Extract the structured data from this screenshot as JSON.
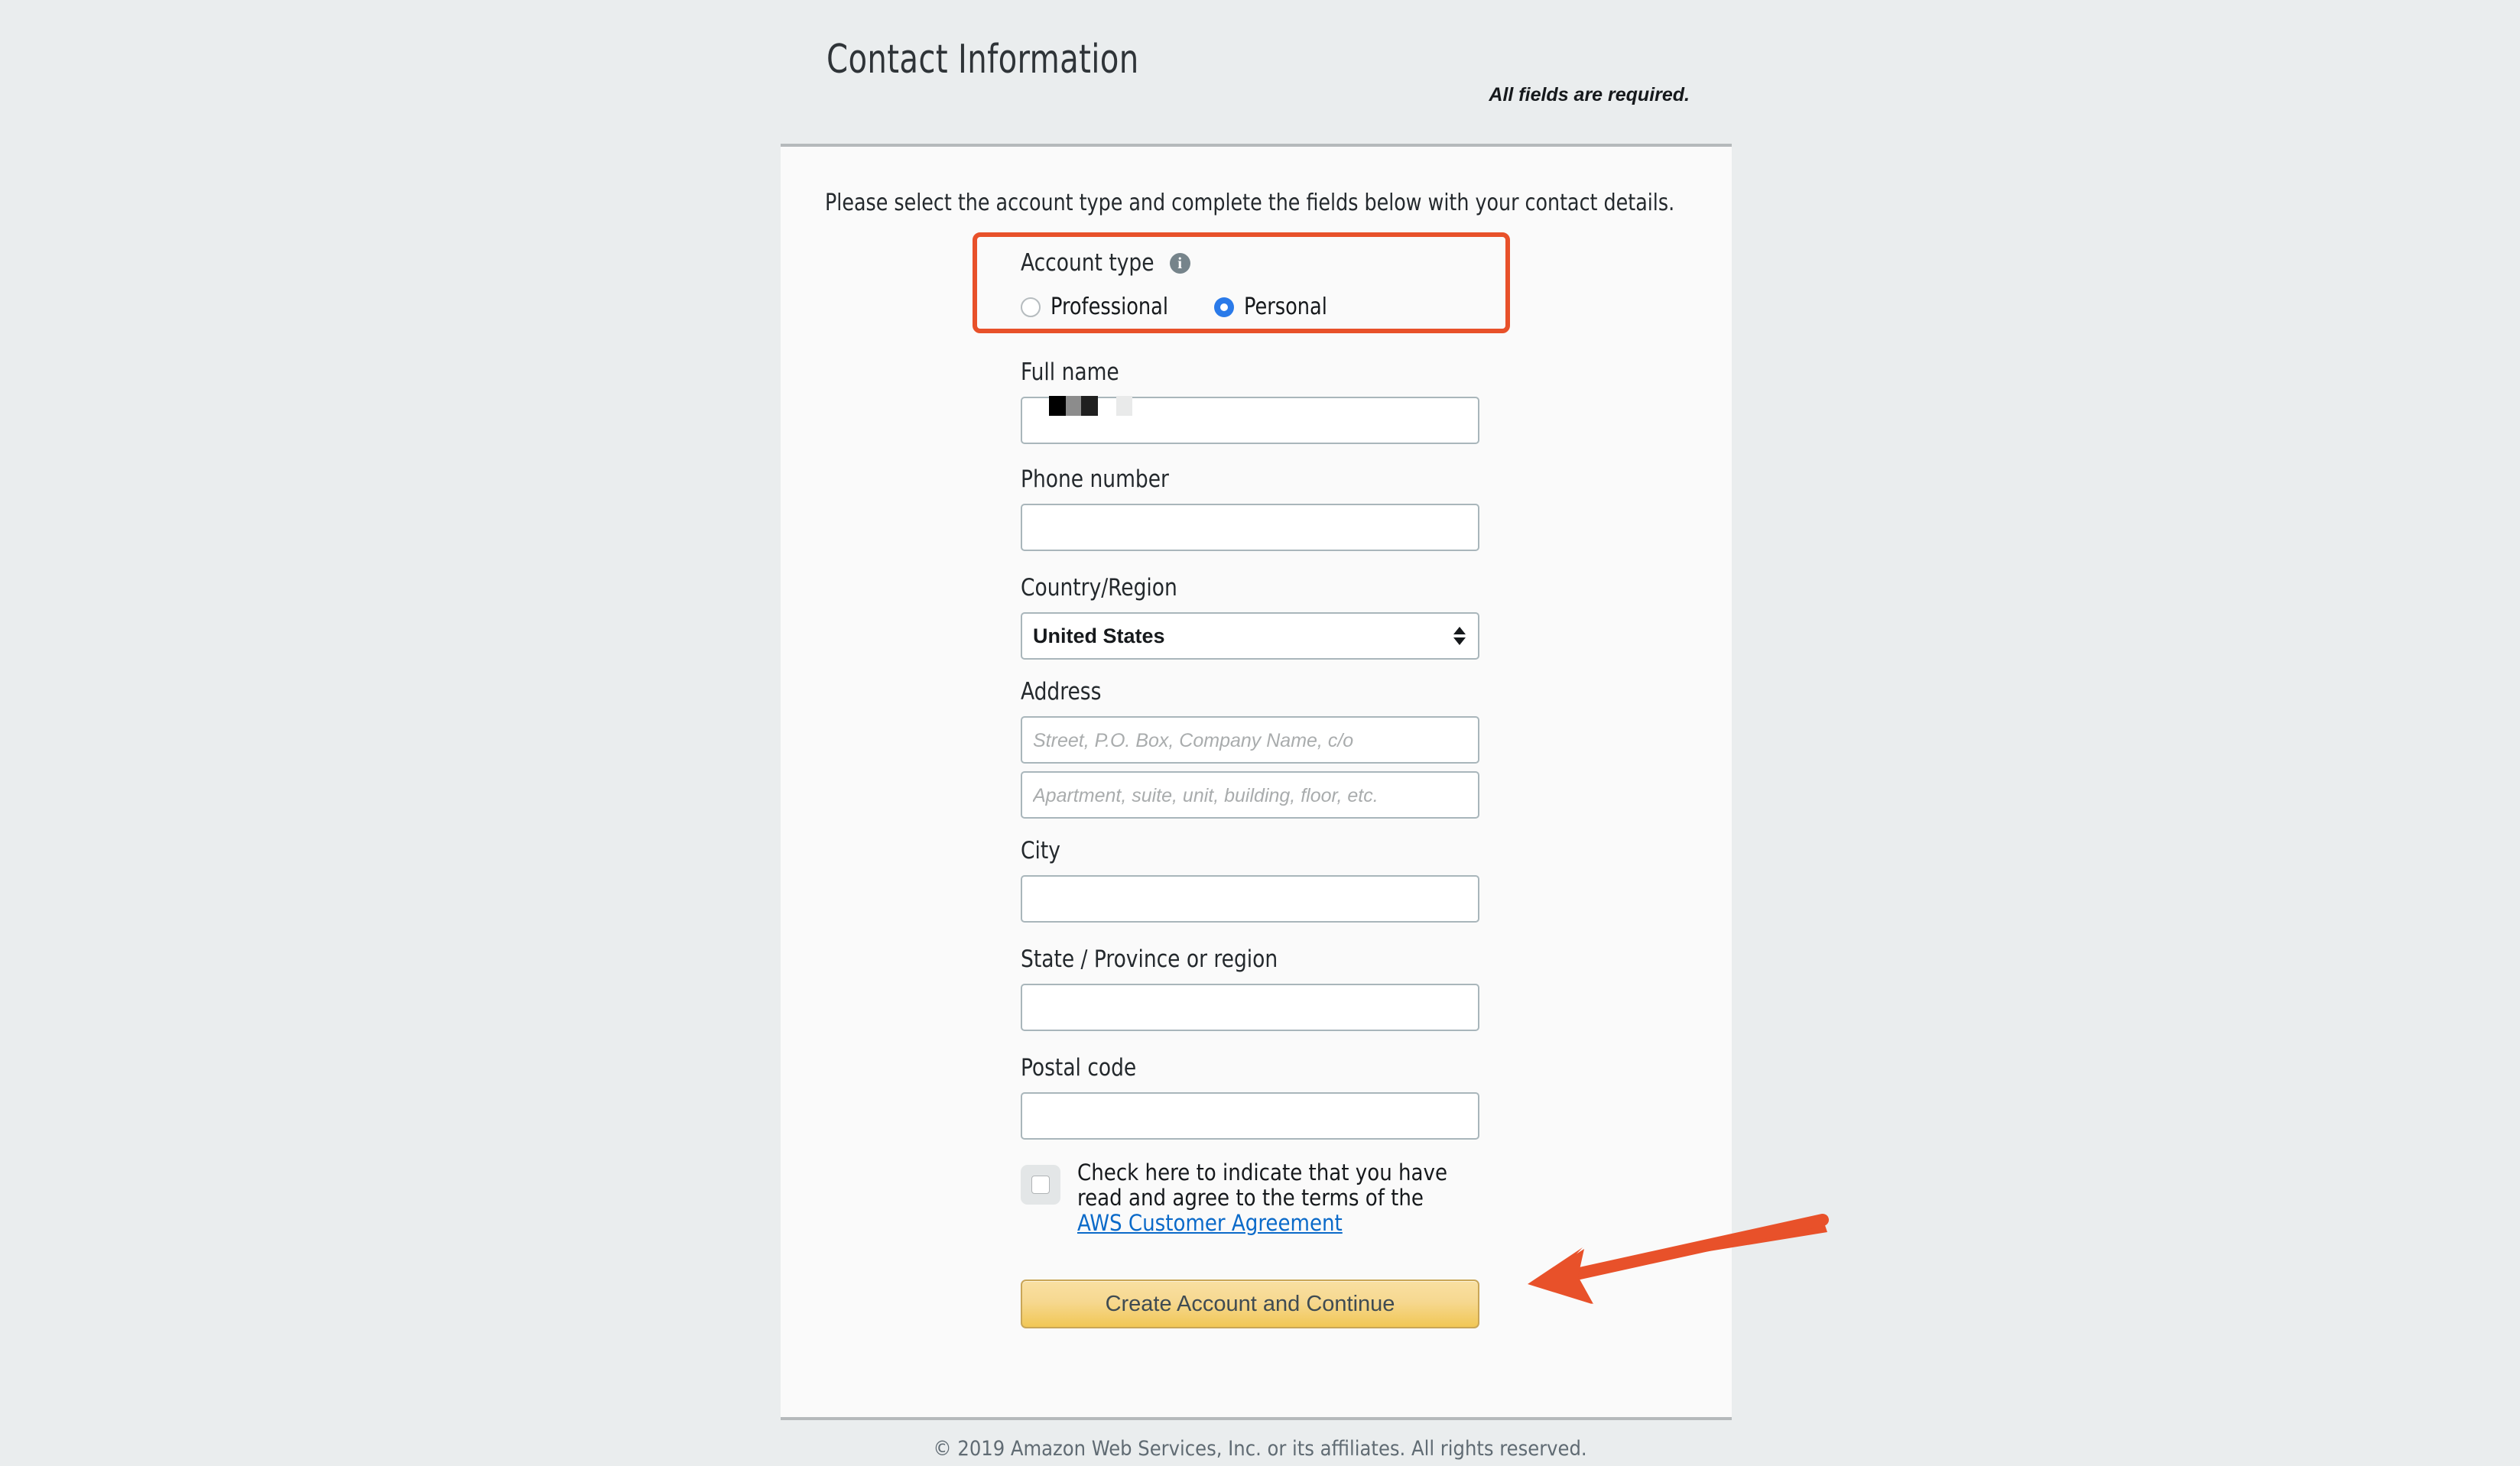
{
  "header": {
    "title": "Contact Information",
    "required_note": "All fields are required."
  },
  "card": {
    "intro": "Please select the account type and complete the fields below with your contact details."
  },
  "account_type": {
    "label": "Account type",
    "info_icon": "info-icon",
    "info_glyph": "i",
    "options": [
      {
        "label": "Professional",
        "selected": false
      },
      {
        "label": "Personal",
        "selected": true
      }
    ],
    "highlight_color": "#e8512a",
    "selected_radio_color": "#2a7ae9"
  },
  "fields": {
    "full_name": {
      "label": "Full name",
      "value": "",
      "redacted": true
    },
    "phone_number": {
      "label": "Phone number",
      "value": "",
      "placeholder": ""
    },
    "country_region": {
      "label": "Country/Region",
      "value": "United States"
    },
    "address": {
      "label": "Address",
      "line1_placeholder": "Street, P.O. Box, Company Name, c/o",
      "line1_value": "",
      "line2_placeholder": "Apartment, suite, unit, building, floor, etc.",
      "line2_value": ""
    },
    "city": {
      "label": "City",
      "value": ""
    },
    "state": {
      "label": "State / Province or region",
      "value": ""
    },
    "postal_code": {
      "label": "Postal code",
      "value": ""
    }
  },
  "agreement": {
    "checked": false,
    "text_part1": "Check here to indicate that you have read and agree to the terms of the ",
    "link_text": "AWS Customer Agreement",
    "link_color": "#0b6ac9"
  },
  "submit": {
    "label": "Create Account and Continue",
    "gradient_top": "#f9e0a2",
    "gradient_bottom": "#f1c755"
  },
  "annotation": {
    "arrow_color": "#e8512a",
    "points_to": "create-account-and-continue-button"
  },
  "footer": {
    "copyright": "© 2019 Amazon Web Services, Inc. or its affiliates. All rights reserved."
  }
}
